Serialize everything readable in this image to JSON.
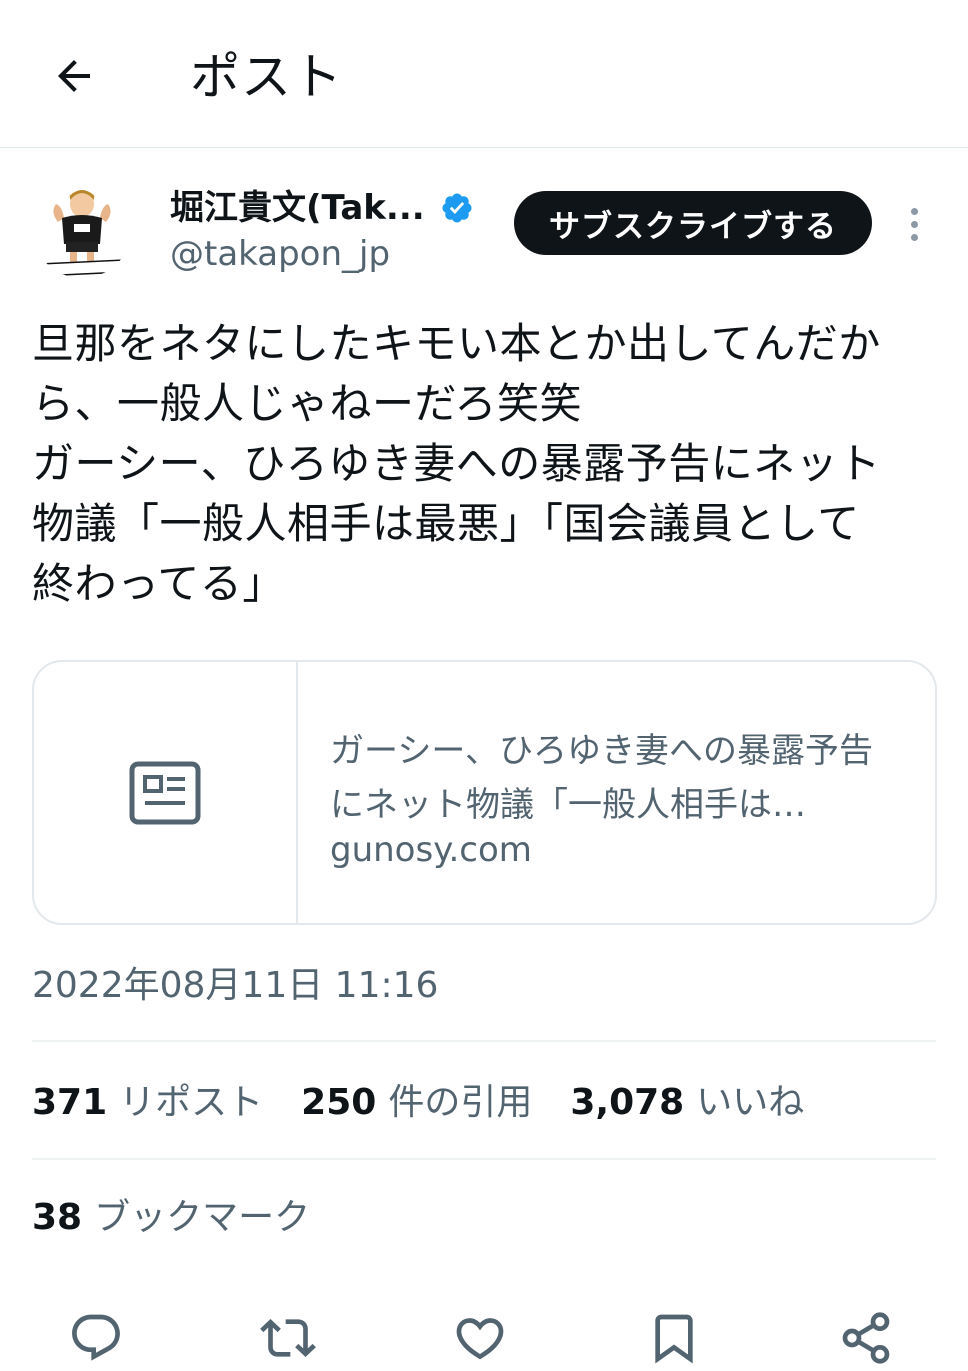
{
  "header": {
    "title": "ポスト",
    "back_icon": "arrow-left-icon"
  },
  "author": {
    "name": "堀江貴文(Tak...",
    "handle": "@takapon_jp",
    "avatar_caption": "リマッチョ",
    "verified_color": "#1d9bf0"
  },
  "subscribe_label": "サブスクライブする",
  "tweet_text": "旦那をネタにしたキモい本とか出してんだか\nら、一般人じゃねーだろ笑笑\nガーシー、ひろゆき妻への暴露予告にネット\n物議「一般人相手は最悪」「国会議員として\n終わってる」",
  "card": {
    "title": "ガーシー、ひろゆき妻への暴露予告にネット物議「一般人相手は…",
    "domain": "gunosy.com",
    "icon": "article-icon"
  },
  "timestamp": "2022年08月11日 11:16",
  "stats": {
    "reposts_count": "371",
    "reposts_label": "リポスト",
    "quotes_count": "250",
    "quotes_label": "件の引用",
    "likes_count": "3,078",
    "likes_label": "いいね"
  },
  "bookmarks": {
    "count": "38",
    "label": "ブックマーク"
  },
  "actions": [
    "reply-icon",
    "repost-icon",
    "like-icon",
    "bookmark-icon",
    "share-icon"
  ],
  "colors": {
    "text": "#0f1419",
    "secondary": "#536471",
    "border": "#eff3f4",
    "button_bg": "#0f1419"
  }
}
